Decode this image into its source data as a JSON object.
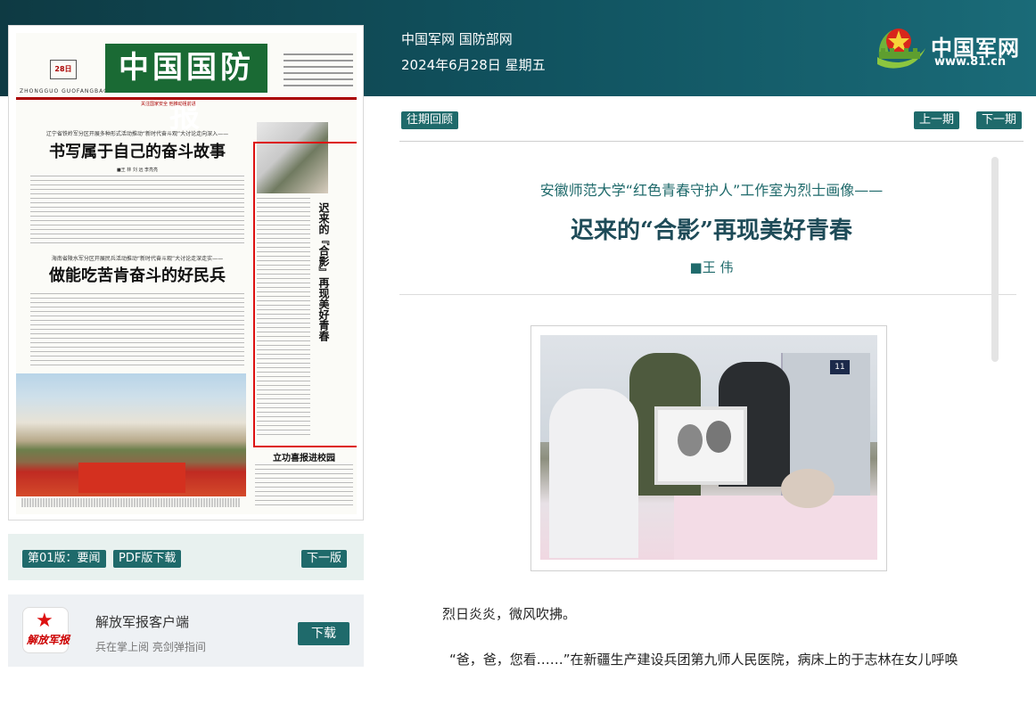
{
  "header": {
    "site_names": "中国军网 国防部网",
    "date": "2024年6月28日 星期五",
    "logo_text": "中国军网",
    "logo_url": "www.81.cn"
  },
  "newspaper": {
    "masthead": "中国国防报",
    "date_box": "28日",
    "pinyin": "ZHONGGUO GUOFANGBAO",
    "slogan": "关注国家安全  他推动祖前进",
    "headline1_kicker": "辽宁省铁岭军分区开展多种形式活动推动“新时代奋斗观”大讨论走向深入——",
    "headline1": "书写属于自己的奋斗故事",
    "byline1": "■王 林  刘 远  李亮亮",
    "headline2_kicker": "海南省陵水军分区开展民兵活动推动“新时代奋斗观”大讨论走深走实——",
    "headline2": "做能吃苦肯奋斗的好民兵",
    "vertical_title": "迟来的『合影』再现美好青春",
    "headline3": "立功喜报进校园"
  },
  "edition_bar": {
    "edition_label": "第01版：要闻",
    "pdf_label": "PDF版下载",
    "next_label": "下一版"
  },
  "app_promo": {
    "icon_brand": "解放军报",
    "title": "解放军报客户端",
    "subtitle": "兵在掌上阅 亮剑弹指间",
    "download_label": "下载"
  },
  "nav": {
    "archive_label": "往期回顾",
    "prev_label": "上一期",
    "next_label": "下一期"
  },
  "article": {
    "subhead": "安徽师范大学“红色青春守护人”工作室为烈士画像——",
    "title": "迟来的“合影”再现美好青春",
    "author": "■王  伟",
    "photo_number": "11",
    "paragraph1": "烈日炎炎，微风吹拂。",
    "paragraph2": "“爸，爸，您看……”在新疆生产建设兵团第九师人民医院，病床上的于志林在女儿呼唤"
  },
  "colors": {
    "header_bg": "#115461",
    "accent": "#1f6a6b",
    "title": "#1e4b58",
    "highlight": "#dd1111"
  }
}
